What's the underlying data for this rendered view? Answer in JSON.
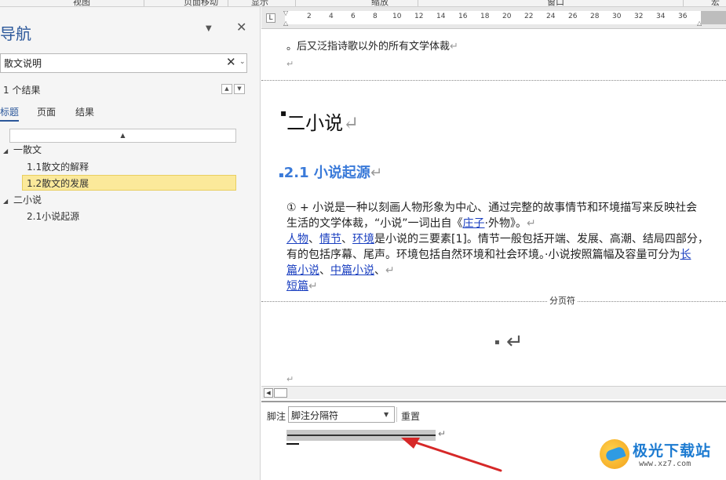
{
  "ribbon": {
    "groups": [
      "视图",
      "页面移动",
      "显示",
      "缩放",
      "窗口",
      "宏"
    ]
  },
  "nav": {
    "title": "导航",
    "search_value": "散文说明",
    "results_count": "1 个结果",
    "tabs": [
      "标题",
      "页面",
      "结果"
    ],
    "collapse_glyph": "▲",
    "tree": [
      {
        "label": "一散文",
        "level": 1,
        "expanded": true
      },
      {
        "label": "1.1散文的解释",
        "level": 2
      },
      {
        "label": "1.2散文的发展",
        "level": 2,
        "selected": true
      },
      {
        "label": "二小说",
        "level": 1,
        "expanded": true
      },
      {
        "label": "2.1小说起源",
        "level": 2
      }
    ]
  },
  "ruler": {
    "numbers": [
      "2",
      "4",
      "6",
      "8",
      "10",
      "12",
      "14",
      "16",
      "18",
      "20",
      "22",
      "24",
      "26",
      "28",
      "30",
      "32",
      "34",
      "36"
    ]
  },
  "document": {
    "line1": "。后又泛指诗歌以外的所有文学体裁",
    "para_mark": "↵",
    "heading1": "二小说",
    "heading2": "2.1 小说起源",
    "p1_line1": "① + 小说是一种以刻画人物形象为中心、通过完整的故事情节和环境描写来反映社会",
    "p1_line2_a": "生活的文学体裁，“小说”一词出自《",
    "p1_line2_link": "庄子",
    "p1_line2_b": "·外物》。",
    "p2_link1": "人物",
    "p2_sep1": "、",
    "p2_link2": "情节",
    "p2_sep2": "、",
    "p2_link3": "环境",
    "p2_rest": "是小说的三要素[1]。情节一般包括开端、发展、高潮、结局四部分，",
    "p3": "有的包括序幕、尾声。环境包括自然环境和社会环境。·小说按照篇幅及容量可分为",
    "p3_link": "长",
    "p4_link1": "篇小说",
    "p4_sep1": "、",
    "p4_link2": "中篇小说",
    "p4_sep2": "、",
    "p5_link": "短篇",
    "page_break_label": "分页符"
  },
  "footnote": {
    "label": "脚注",
    "select_value": "脚注分隔符",
    "reset_label": "重置"
  },
  "watermark": {
    "title": "极光下载站",
    "url": "www.xz7.com"
  },
  "colors": {
    "nav_title": "#2b579a",
    "selected_highlight": "#fbe99a",
    "heading2": "#3a7ad9",
    "link": "#1a3fc0",
    "annotation_arrow": "#d62828"
  }
}
